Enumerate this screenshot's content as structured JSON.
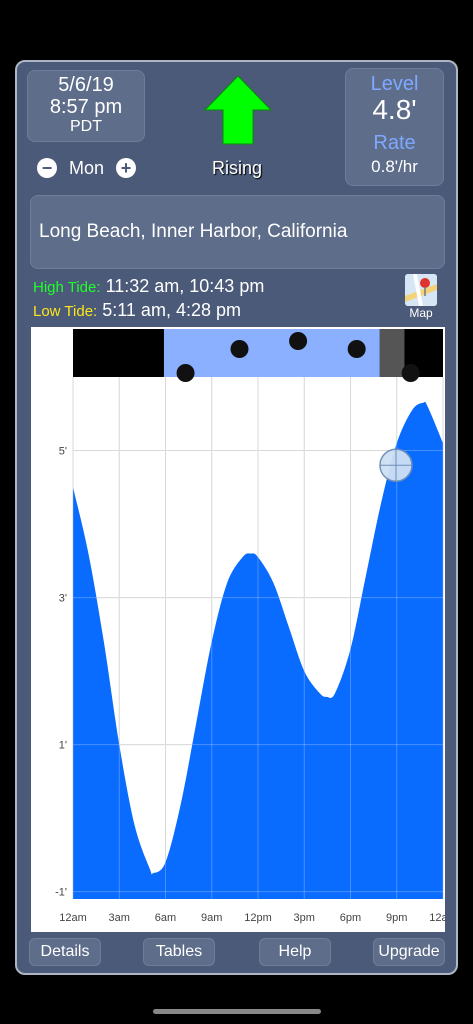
{
  "header": {
    "date": "5/6/19",
    "time": "8:57 pm",
    "timezone": "PDT",
    "day_label": "Mon",
    "trend_label": "Rising",
    "level_heading": "Level",
    "level_value": "4.8'",
    "rate_heading": "Rate",
    "rate_value": "0.8'/hr"
  },
  "station": {
    "name": "Long Beach, Inner Harbor, California"
  },
  "tides": {
    "high_label": "High Tide:",
    "high_times": "11:32 am, 10:43 pm",
    "low_label": "Low Tide:",
    "low_times": "5:11 am, 4:28 pm"
  },
  "map_button": {
    "label": "Map"
  },
  "footer": {
    "details": "Details",
    "tables": "Tables",
    "help": "Help",
    "upgrade": "Upgrade"
  },
  "colors": {
    "accent": "#7fa8ff",
    "high_tide": "#21ff2a",
    "low_tide": "#ffe61a",
    "tide_fill": "#0a6cff",
    "arrow": "#00ff00",
    "panel": "#4a5a78"
  },
  "chart_data": {
    "type": "area",
    "x": [
      0,
      1,
      2,
      3,
      4,
      5,
      5.18,
      6,
      7,
      8,
      9,
      10,
      11,
      11.53,
      12,
      13,
      14,
      15,
      16,
      16.47,
      17,
      18,
      19,
      20,
      21,
      22,
      22.72,
      23,
      24
    ],
    "values": [
      4.5,
      3.6,
      2.4,
      1.0,
      -0.1,
      -0.7,
      -0.75,
      -0.6,
      0.2,
      1.3,
      2.4,
      3.2,
      3.55,
      3.6,
      3.55,
      3.2,
      2.6,
      2.0,
      1.7,
      1.65,
      1.7,
      2.3,
      3.3,
      4.3,
      5.1,
      5.55,
      5.65,
      5.6,
      5.1
    ],
    "x_ticks": [
      "12am",
      "3am",
      "6am",
      "9am",
      "12pm",
      "3pm",
      "6pm",
      "9pm",
      "12am"
    ],
    "y_ticks": [
      "-1'",
      "1'",
      "3'",
      "5'"
    ],
    "y_tick_values": [
      -1,
      1,
      3,
      5
    ],
    "ylim": [
      -1.1,
      6.0
    ],
    "xlim": [
      0,
      24
    ],
    "current_point": {
      "x": 20.95,
      "y": 4.8
    },
    "grid": true
  }
}
